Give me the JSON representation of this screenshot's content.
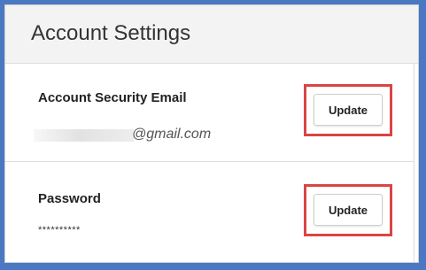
{
  "header": {
    "title": "Account Settings"
  },
  "email_section": {
    "title": "Account Security Email",
    "value_visible": "@gmail.com",
    "update_label": "Update"
  },
  "password_section": {
    "title": "Password",
    "value": "**********",
    "update_label": "Update"
  },
  "colors": {
    "frame_border": "#4a78c2",
    "highlight": "#d94545",
    "header_bg": "#f3f3f3"
  }
}
